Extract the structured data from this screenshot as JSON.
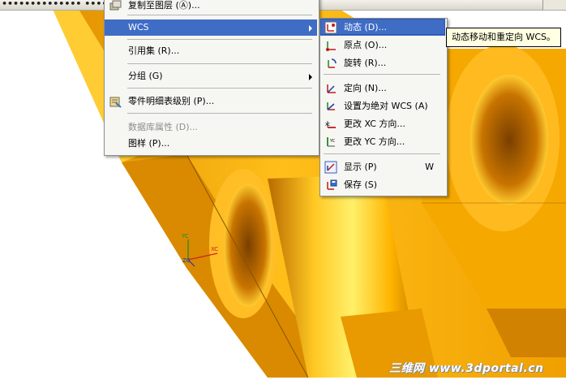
{
  "title_bar": {
    "text": "••••••••••••••  ••••"
  },
  "main_menu": {
    "items": [
      {
        "label": "复制至图层 (Ⓐ)...",
        "disabled": false
      },
      {
        "label": "WCS",
        "submenu": true,
        "highlight": true
      },
      {
        "label": "引用集 (R)..."
      },
      {
        "label": "分组 (G)",
        "submenu": true
      },
      {
        "label": "零件明细表级别 (P)..."
      },
      {
        "label": "数据库属性 (D)...",
        "disabled": true
      },
      {
        "label": "图样 (P)..."
      }
    ]
  },
  "wcs_submenu": {
    "items": [
      {
        "label": "动态 (D)...",
        "highlight": true,
        "icon": "dynamic-wcs-icon"
      },
      {
        "label": "原点 (O)...",
        "icon": "origin-icon"
      },
      {
        "label": "旋转 (R)...",
        "icon": "rotate-icon"
      },
      {
        "label": "定向 (N)...",
        "icon": "orient-icon"
      },
      {
        "label": "设置为绝对 WCS (A)",
        "icon": "absolute-wcs-icon"
      },
      {
        "label": "更改 XC 方向...",
        "icon": "change-xc-icon"
      },
      {
        "label": "更改 YC 方向...",
        "icon": "change-yc-icon"
      },
      {
        "label": "显示 (P)",
        "shortcut": "W",
        "icon": "display-icon"
      },
      {
        "label": "保存 (S)",
        "icon": "save-icon"
      }
    ]
  },
  "tooltip": {
    "text": "动态移动和重定向 WCS。"
  },
  "triad": {
    "yc": "YC",
    "xc": "XC",
    "zc": "ZC"
  },
  "watermark": {
    "text": "三维网 www.3dportal.cn"
  },
  "colors": {
    "part_orange": "#f5a800",
    "part_light": "#ffd23a",
    "background_white": "#ffffff",
    "menu_highlight": "#3f6dc6",
    "tooltip_bg": "#ffffe1"
  }
}
